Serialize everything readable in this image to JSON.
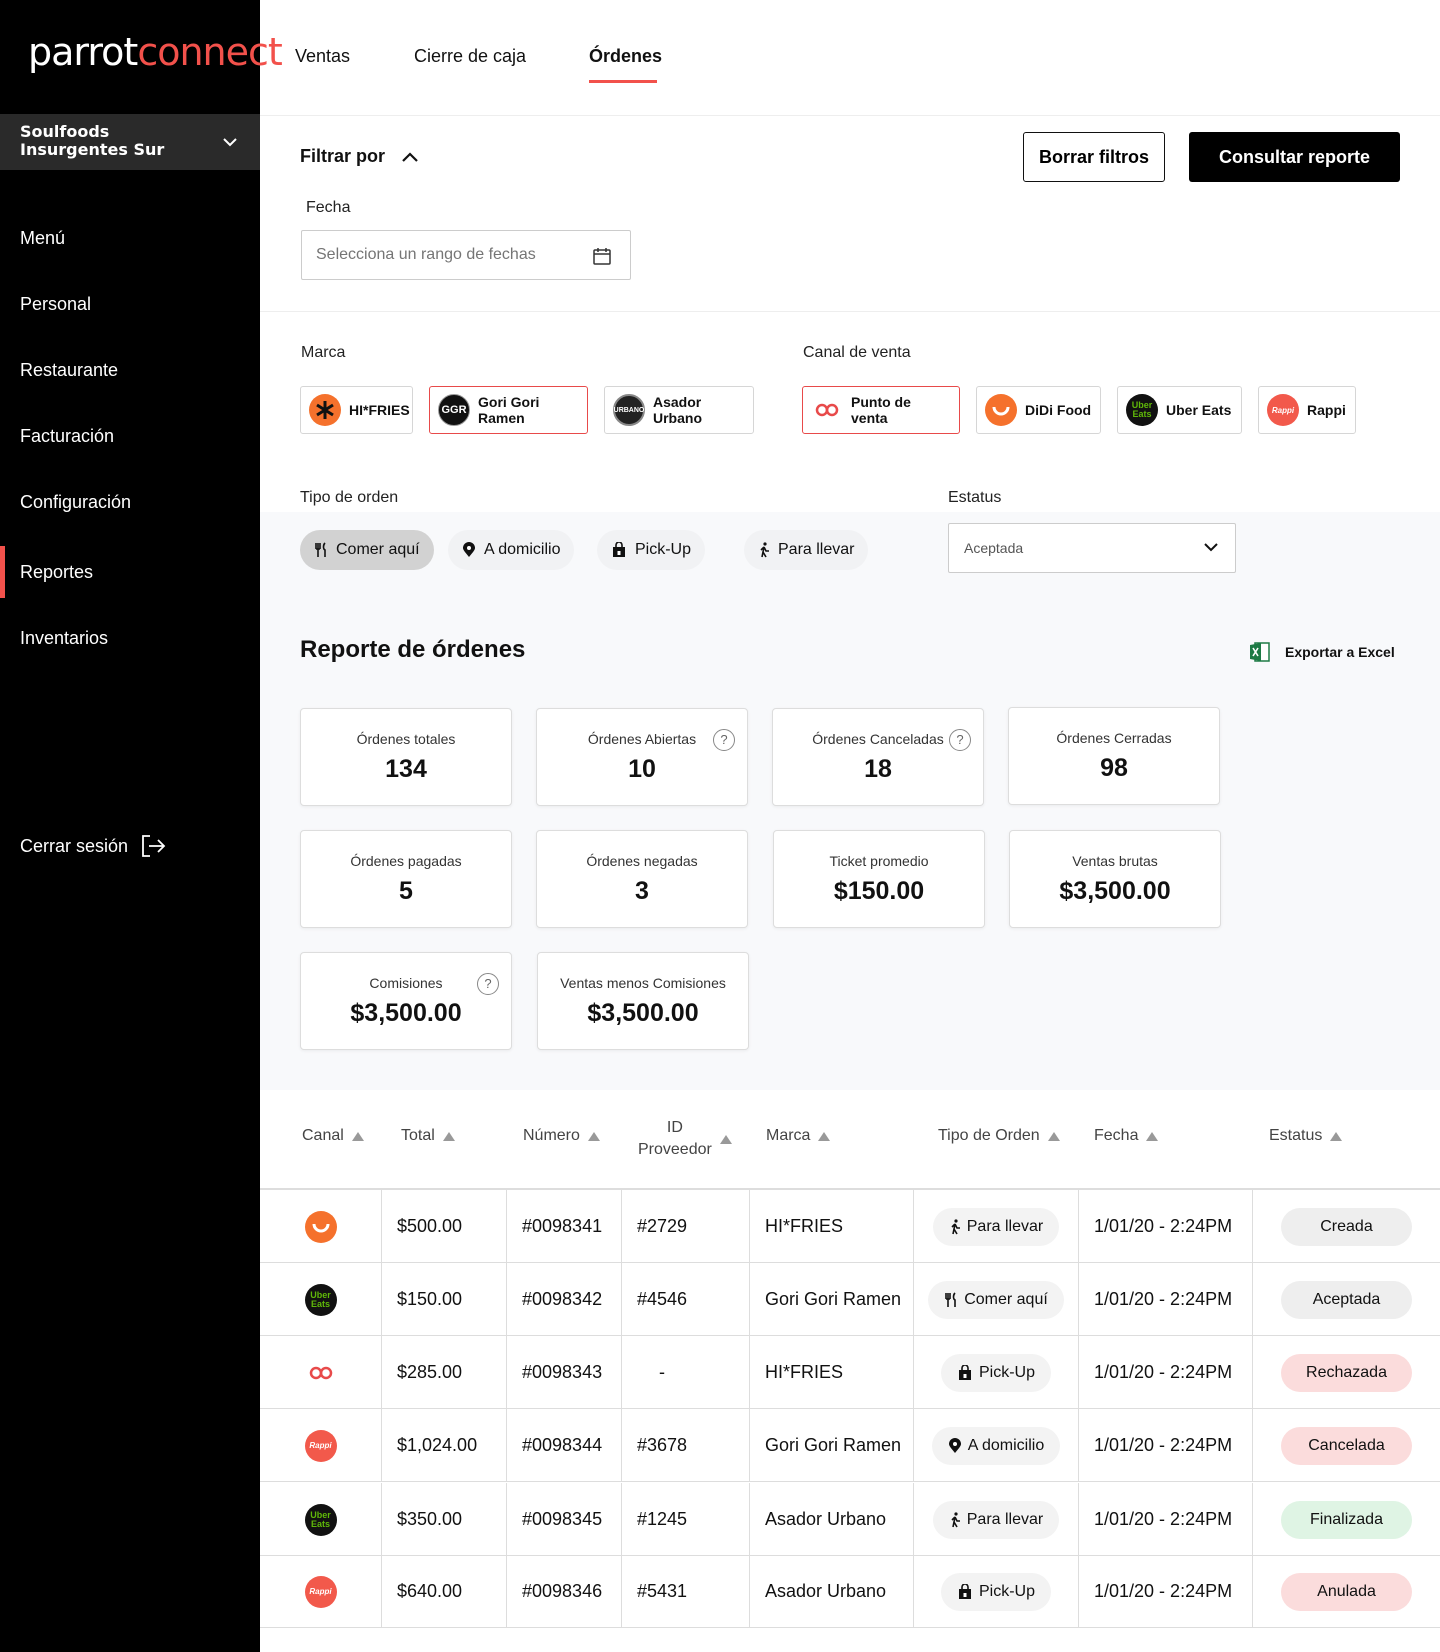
{
  "brand": {
    "part1": "parrot",
    "part2": "connect"
  },
  "store": {
    "line1": "Soulfoods",
    "line2": "Insurgentes Sur"
  },
  "nav": [
    {
      "label": "Menú"
    },
    {
      "label": "Personal"
    },
    {
      "label": "Restaurante"
    },
    {
      "label": "Facturación"
    },
    {
      "label": "Configuración"
    },
    {
      "label": "Reportes",
      "active": true
    },
    {
      "label": "Inventarios"
    }
  ],
  "logout_label": "Cerrar sesión",
  "tabs": [
    {
      "label": "Ventas"
    },
    {
      "label": "Cierre de caja"
    },
    {
      "label": "Órdenes",
      "active": true
    }
  ],
  "filters": {
    "title": "Filtrar por",
    "clear_label": "Borrar filtros",
    "submit_label": "Consultar reporte",
    "date_label": "Fecha",
    "date_placeholder": "Selecciona un rango de fechas",
    "brand_label": "Marca",
    "channel_label": "Canal de venta",
    "brands": [
      {
        "label": "HI*FRIES",
        "icon_text": ""
      },
      {
        "label": "Gori Gori Ramen",
        "icon_text": "GGR",
        "selected": true
      },
      {
        "label": "Asador Urbano",
        "icon_text": "URBANO"
      }
    ],
    "channels": [
      {
        "label": "Punto de venta",
        "selected": true
      },
      {
        "label": "DiDi Food"
      },
      {
        "label": "Uber Eats",
        "icon_text": "Uber Eats"
      },
      {
        "label": "Rappi",
        "icon_text": "Rappi"
      }
    ],
    "order_type_label": "Tipo de orden",
    "order_types": [
      {
        "label": "Comer aquí",
        "icon": "utensils-icon",
        "selected": true
      },
      {
        "label": "A domicilio",
        "icon": "location-pin-icon"
      },
      {
        "label": "Pick-Up",
        "icon": "bag-icon"
      },
      {
        "label": "Para llevar",
        "icon": "walking-icon"
      }
    ],
    "status_label": "Estatus",
    "status_value": "Aceptada"
  },
  "report": {
    "title": "Reporte de órdenes",
    "export_label": "Exportar a Excel",
    "cards": [
      {
        "title": "Órdenes totales",
        "value": "134"
      },
      {
        "title": "Órdenes Abiertas",
        "value": "10",
        "help": "?"
      },
      {
        "title": "Órdenes Canceladas",
        "value": "18",
        "help": "?"
      },
      {
        "title": "Órdenes Cerradas",
        "value": "98"
      },
      {
        "title": "Órdenes pagadas",
        "value": "5"
      },
      {
        "title": "Órdenes negadas",
        "value": "3"
      },
      {
        "title": "Ticket promedio",
        "value": "$150.00"
      },
      {
        "title": "Ventas brutas",
        "value": "$3,500.00"
      },
      {
        "title": "Comisiones",
        "value": "$3,500.00",
        "help": "?"
      },
      {
        "title": "Ventas menos Comisiones",
        "value": "$3,500.00"
      }
    ]
  },
  "table": {
    "columns": [
      "Canal",
      "Total",
      "Número",
      "ID",
      "Proveedor",
      "Marca",
      "Tipo de Orden",
      "Fecha",
      "Estatus"
    ],
    "rows": [
      {
        "channel": "didi",
        "channel_text": "",
        "total": "$500.00",
        "number": "#0098341",
        "provider_id": "#2729",
        "brand": "HI*FRIES",
        "type": "Para llevar",
        "type_icon": "walking-icon",
        "date": "1/01/20 - 2:24PM",
        "status": "Creada",
        "status_color": "#eeeeee"
      },
      {
        "channel": "uber",
        "channel_text": "Uber Eats",
        "total": "$150.00",
        "number": "#0098342",
        "provider_id": "#4546",
        "brand": "Gori Gori Ramen",
        "type": "Comer aquí",
        "type_icon": "utensils-icon",
        "date": "1/01/20 - 2:24PM",
        "status": "Aceptada",
        "status_color": "#eeeeee"
      },
      {
        "channel": "pos",
        "channel_text": "",
        "total": "$285.00",
        "number": "#0098343",
        "provider_id": "-",
        "brand": "HI*FRIES",
        "type": "Pick-Up",
        "type_icon": "bag-icon",
        "date": "1/01/20 - 2:24PM",
        "status": "Rechazada",
        "status_color": "#fbdcdc"
      },
      {
        "channel": "rappi",
        "channel_text": "Rappi",
        "total": "$1,024.00",
        "number": "#0098344",
        "provider_id": "#3678",
        "brand": "Gori Gori Ramen",
        "type": "A domicilio",
        "type_icon": "location-pin-icon",
        "date": "1/01/20 - 2:24PM",
        "status": "Cancelada",
        "status_color": "#fbdcdc"
      },
      {
        "channel": "uber",
        "channel_text": "Uber Eats",
        "total": "$350.00",
        "number": "#0098345",
        "provider_id": "#1245",
        "brand": "Asador Urbano",
        "type": "Para llevar",
        "type_icon": "walking-icon",
        "date": "1/01/20 - 2:24PM",
        "status": "Finalizada",
        "status_color": "#dff4e4"
      },
      {
        "channel": "rappi",
        "channel_text": "Rappi",
        "total": "$640.00",
        "number": "#0098346",
        "provider_id": "#5431",
        "brand": "Asador Urbano",
        "type": "Pick-Up",
        "type_icon": "bag-icon",
        "date": "1/01/20 - 2:24PM",
        "status": "Anulada",
        "status_color": "#fbdcdc"
      }
    ]
  },
  "colors": {
    "accent": "#f2514b",
    "sidebar": "#000000",
    "band": "#f8f9fb",
    "didi": "#f5712c",
    "rappi": "#f2594b",
    "uber_green": "#5fb709"
  }
}
